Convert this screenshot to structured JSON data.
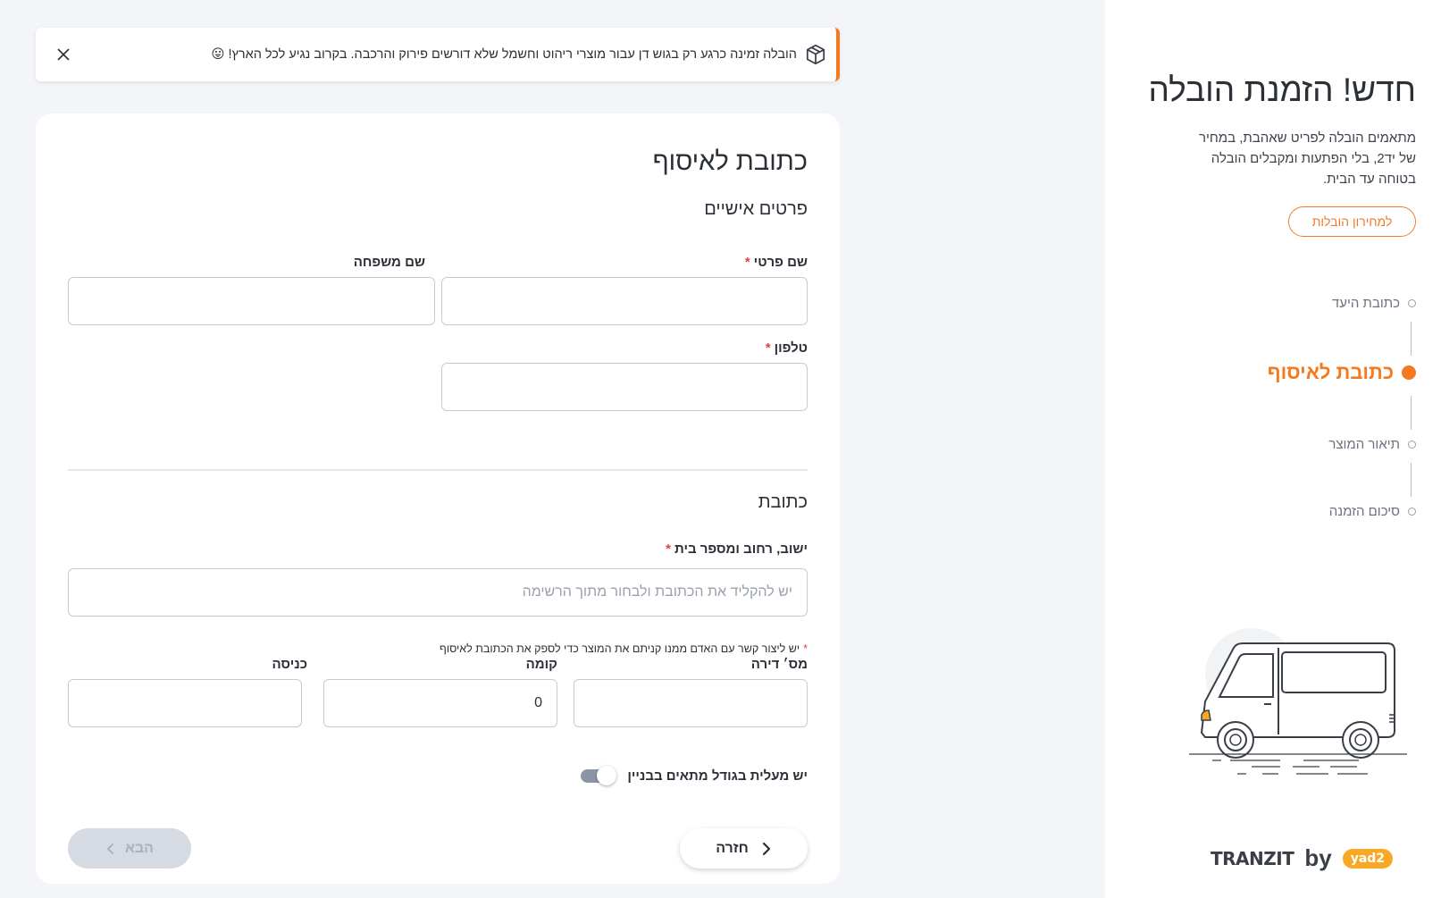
{
  "banner": {
    "text": "הובלה זמינה כרגע רק בגוש דן עבור מוצרי ריהוט וחשמל שלא דורשים פירוק והרכבה. בקרוב נגיע לכל הארץ!",
    "emoji": "😛",
    "icon": "package-icon",
    "close_icon": "close-icon"
  },
  "sidebar": {
    "title": "חדש! הזמנת הובלה",
    "description": "מתאמים הובלה לפריט שאהבת, במחיר של יד2, בלי הפתעות ומקבלים הובלה בטוחה עד הבית.",
    "price_list_button": "למחירון הובלות",
    "steps": [
      {
        "label": "כתובת היעד",
        "active": false
      },
      {
        "label": "כתובת לאיסוף",
        "active": true
      },
      {
        "label": "תיאור המוצר",
        "active": false
      },
      {
        "label": "סיכום הזמנה",
        "active": false
      }
    ],
    "accent_color": "#f57a1f",
    "brand": {
      "tranzit": "TRANZIT",
      "by": "by",
      "yad2": "yad2"
    }
  },
  "form": {
    "title": "כתובת לאיסוף",
    "personal_section": "פרטים אישיים",
    "first_name_label": "שם פרטי",
    "last_name_label": "שם משפחה",
    "phone_label": "טלפון",
    "required_mark": "*",
    "address_section": "כתובת",
    "address_label": "ישוב, רחוב ומספר בית",
    "address_placeholder": "יש להקליד את הכתובת ולבחור מתוך הרשימה",
    "address_note": "יש ליצור קשר עם האדם ממנו קניתם את המוצר כדי לספק את הכתובת לאיסוף",
    "apartment_label": "מס׳ דירה",
    "floor_label": "קומה",
    "floor_value": "0",
    "entrance_label": "כניסה",
    "elevator_label": "יש מעלית בגודל מתאים בבניין",
    "back_button": "חזרה",
    "next_button": "הבא"
  }
}
